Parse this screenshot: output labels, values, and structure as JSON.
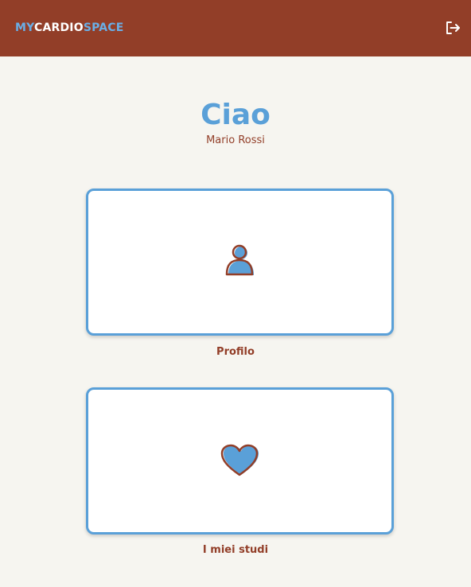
{
  "header": {
    "logo": {
      "part1": "MY",
      "part2": "CARDIO",
      "part3": "SPACE"
    },
    "logout_icon": "logout-icon"
  },
  "greeting": {
    "title": "Ciao",
    "user_name": "Mario Rossi"
  },
  "cards": [
    {
      "label": "Profilo",
      "icon": "user-icon"
    },
    {
      "label": "I miei studi",
      "icon": "heart-icon"
    }
  ],
  "colors": {
    "header_bg": "#923e28",
    "accent_blue": "#5aa0d8",
    "text_brown": "#923e28",
    "page_bg": "#f6f5f0"
  }
}
